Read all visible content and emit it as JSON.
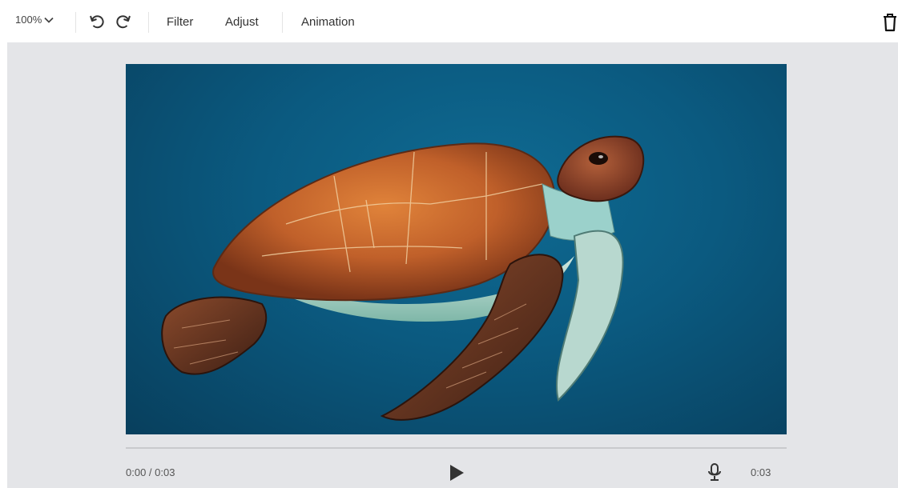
{
  "toolbar": {
    "zoom_label": "100%",
    "menu": [
      "Filter",
      "Adjust",
      "Animation"
    ]
  },
  "icons": {
    "zoom_dropdown": "chevron-down-icon",
    "undo": "undo-icon",
    "redo": "redo-icon",
    "delete": "trash-icon",
    "play": "play-icon",
    "voice": "microphone-icon"
  },
  "player": {
    "current_time": "0:00 / 0:03",
    "duration": "0:03",
    "progress": 0
  },
  "colors": {
    "workspace_bg": "#e4e5e8",
    "water": "#0b5a80",
    "shell": "#c8662b"
  }
}
